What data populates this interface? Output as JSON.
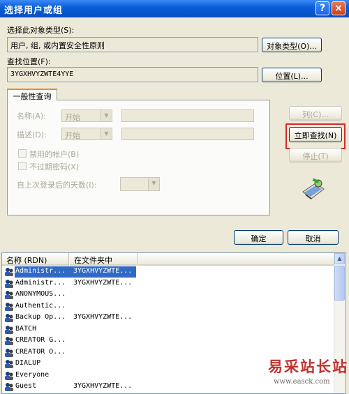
{
  "window": {
    "title": "选择用户或组",
    "help_glyph": "?",
    "close_glyph": "×"
  },
  "object_type": {
    "label": "选择此对象类型(S):",
    "value": "用户, 组, 或内置安全性原则",
    "button": "对象类型(O)..."
  },
  "location": {
    "label": "查找位置(F):",
    "value": "3YGXHVYZWTE4YYE",
    "button": "位置(L)..."
  },
  "query": {
    "tab_label": "一般性查询",
    "name_label": "名称(A):",
    "name_combo": "开始",
    "desc_label": "描述(D):",
    "desc_combo": "开始",
    "disabled_accounts": "禁用的帐户(B)",
    "no_expire_pwd": "不过期密码(X)",
    "days_since_logon": "自上次登录后的天数(I):"
  },
  "buttons": {
    "columns": "列(C)...",
    "find_now": "立即查找(N)",
    "stop": "停止(T)",
    "ok": "确定",
    "cancel": "取消"
  },
  "results": {
    "headers": [
      "名称 (RDN)",
      "在文件夹中"
    ],
    "rows": [
      {
        "name": "Administr...",
        "folder": "3YGXHVYZWTE...",
        "selected": true
      },
      {
        "name": "Administr...",
        "folder": "3YGXHVYZWTE..."
      },
      {
        "name": "ANONYMOUS...",
        "folder": ""
      },
      {
        "name": "Authentic...",
        "folder": ""
      },
      {
        "name": "Backup Op...",
        "folder": "3YGXHVYZWTE..."
      },
      {
        "name": "BATCH",
        "folder": ""
      },
      {
        "name": "CREATOR G...",
        "folder": ""
      },
      {
        "name": "CREATOR O...",
        "folder": ""
      },
      {
        "name": "DIALUP",
        "folder": ""
      },
      {
        "name": "Everyone",
        "folder": ""
      },
      {
        "name": "Guest",
        "folder": "3YGXHVYZWTE..."
      }
    ]
  },
  "watermark": {
    "text": "易采站长站",
    "url": "www.easck.com"
  },
  "colors": {
    "title_bar": "#0a5fd8",
    "selection": "#316ac5",
    "highlight_box": "#d32a2a"
  }
}
